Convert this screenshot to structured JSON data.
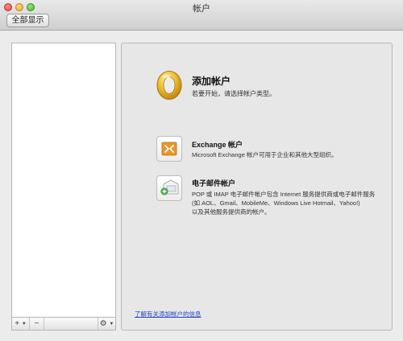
{
  "window": {
    "title": "帐户",
    "show_all_label": "全部显示"
  },
  "list_toolbar": {
    "add_label": "+",
    "remove_label": "−",
    "gear_label": "⚙"
  },
  "main": {
    "heading": "添加帐户",
    "subheading": "若要开始，请选择帐户类型。",
    "options": [
      {
        "title": "Exchange 帐户",
        "description": "Microsoft Exchange 帐户可用于企业和其他大型组织。"
      },
      {
        "title": "电子邮件帐户",
        "description_lines": [
          "POP 或 IMAP 电子邮件帐户包含 Internet 服务提供商或电子邮件服务",
          "(如 AOL、Gmail、MobileMe、Windows Live Hotmail、Yahoo!)",
          "以及其他服务提供商的帐户。"
        ]
      }
    ],
    "learn_more_link": "了解有关添加帐户的信息"
  },
  "colors": {
    "outlook_gold": "#e8b321",
    "exchange_orange": "#e9962a",
    "link_blue": "#2444c8"
  }
}
